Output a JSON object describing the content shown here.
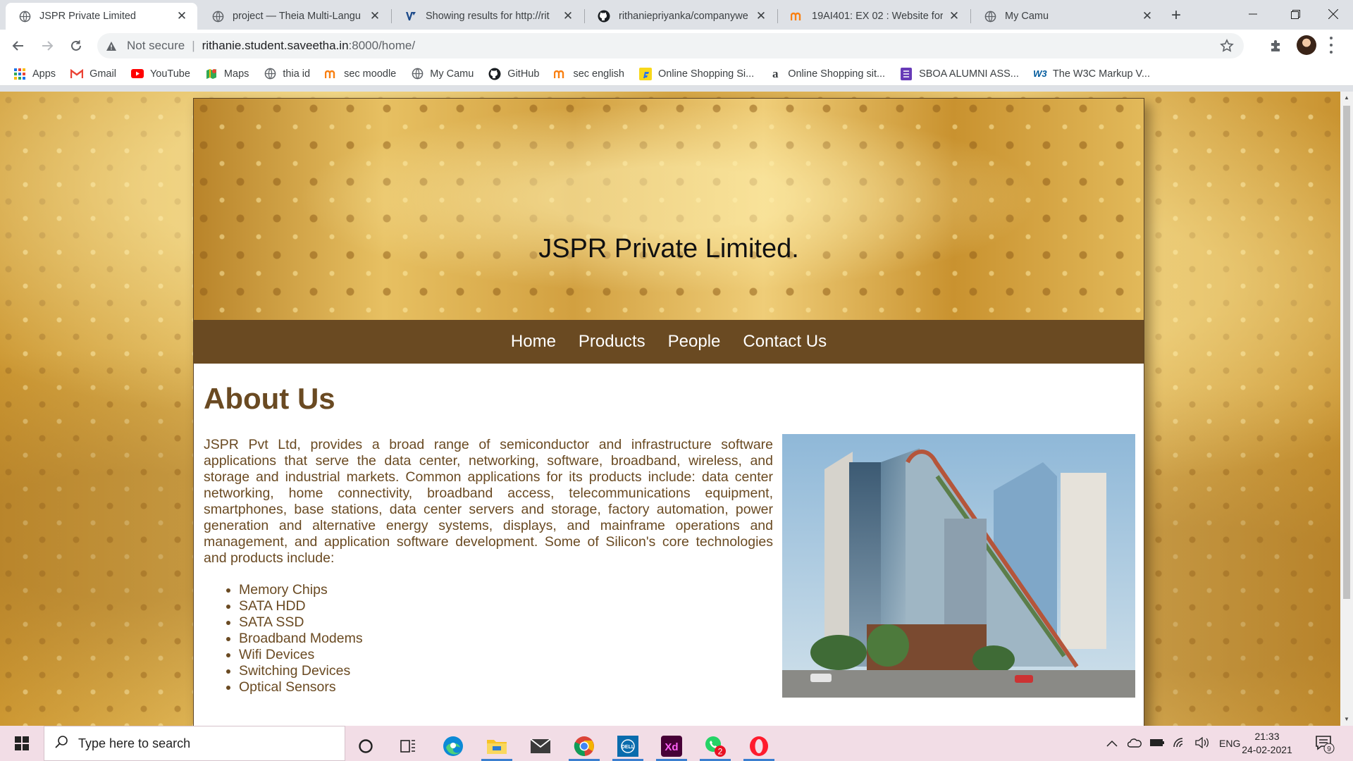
{
  "browser": {
    "tabs": [
      {
        "title": "JSPR Private Limited",
        "icon": "globe-icon",
        "active": true
      },
      {
        "title": "project — Theia Multi-Langu",
        "icon": "globe-icon",
        "active": false
      },
      {
        "title": "Showing results for http://rit",
        "icon": "validator-icon",
        "active": false
      },
      {
        "title": "rithaniepriyanka/companywe",
        "icon": "github-icon",
        "active": false
      },
      {
        "title": "19AI401: EX 02 : Website for",
        "icon": "moodle-icon",
        "active": false
      },
      {
        "title": "My Camu",
        "icon": "globe-icon",
        "active": false
      }
    ],
    "address": {
      "not_secure": "Not secure",
      "host": "rithanie.student.saveetha.in",
      "path": ":8000/home/"
    },
    "bookmarks": [
      {
        "label": "Apps",
        "icon": "apps-grid-icon"
      },
      {
        "label": "Gmail",
        "icon": "gmail-icon"
      },
      {
        "label": "YouTube",
        "icon": "youtube-icon"
      },
      {
        "label": "Maps",
        "icon": "maps-icon"
      },
      {
        "label": "thia id",
        "icon": "globe-icon"
      },
      {
        "label": "sec moodle",
        "icon": "moodle-icon"
      },
      {
        "label": "My Camu",
        "icon": "globe-icon"
      },
      {
        "label": "GitHub",
        "icon": "github-icon"
      },
      {
        "label": "sec english",
        "icon": "moodle-icon"
      },
      {
        "label": "Online Shopping Si...",
        "icon": "flipkart-icon"
      },
      {
        "label": "Online Shopping sit...",
        "icon": "amazon-icon"
      },
      {
        "label": "SBOA ALUMNI ASS...",
        "icon": "form-icon"
      },
      {
        "label": "The W3C Markup V...",
        "icon": "w3c-icon"
      }
    ]
  },
  "page": {
    "title": "JSPR Private Limited.",
    "nav": [
      "Home",
      "Products",
      "People",
      "Contact Us"
    ],
    "heading": "About Us",
    "paragraph": "JSPR Pvt Ltd, provides a broad range of semiconductor and infrastructure software applications that serve the data center, networking, software, broadband, wireless, and storage and industrial markets. Common applications for its products include: data center networking, home connectivity, broadband access, telecommunications equipment, smartphones, base stations, data center servers and storage, factory automation, power generation and alternative energy systems, displays, and mainframe operations and management, and application software development. Some of Silicon's core technologies and products include:",
    "products": [
      "Memory Chips",
      "SATA HDD",
      "SATA SSD",
      "Broadband Modems",
      "Wifi Devices",
      "Switching Devices",
      "Optical Sensors"
    ],
    "image": "office-building-photo",
    "colors": {
      "brown": "#6a4a22",
      "gold": "#d9a93f"
    }
  },
  "taskbar": {
    "search_placeholder": "Type here to search",
    "language": "ENG",
    "time": "21:33",
    "date": "24-02-2021",
    "whatsapp_badge": "2",
    "notification_count": "9",
    "apps": [
      "cortana-icon",
      "task-view-icon",
      "edge-icon",
      "file-explorer-icon",
      "mail-icon",
      "chrome-icon",
      "dell-icon",
      "adobe-xd-icon",
      "whatsapp-icon",
      "opera-icon"
    ]
  }
}
